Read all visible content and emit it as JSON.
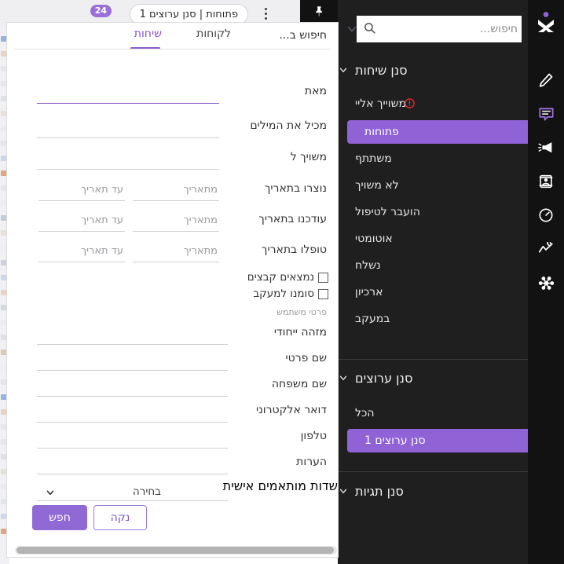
{
  "window": {
    "pin_icon": "pin-icon"
  },
  "tabbar": {
    "tab_label": "פתוחות  |  סנן ערוצים 1",
    "tab_badge": "24",
    "kebab_icon": "more-vertical-icon"
  },
  "panel": {
    "search": {
      "placeholder": "חיפוש...",
      "value": "",
      "icon": "search-icon",
      "caret_icon": "chevron-down-icon"
    },
    "sections": [
      {
        "title": "סנן שיחות",
        "chevron": "chevron-down-icon",
        "items": [
          {
            "label": "משוייך אליי",
            "active": false,
            "alert_icon": "alert-circle-icon"
          },
          {
            "label": "פתוחות",
            "active": true
          },
          {
            "label": "משתתף",
            "active": false
          },
          {
            "label": "לא משויך",
            "active": false
          },
          {
            "label": "הועבר לטיפול",
            "active": false
          },
          {
            "label": "אוטומטי",
            "active": false
          },
          {
            "label": "נשלח",
            "active": false
          },
          {
            "label": "ארכיון",
            "active": false
          },
          {
            "label": "במעקב",
            "active": false
          }
        ]
      },
      {
        "title": "סנן ערוצים",
        "chevron": "chevron-down-icon",
        "items": [
          {
            "label": "הכל",
            "active": false
          },
          {
            "label": "סנן ערוצים 1",
            "active": true
          }
        ]
      },
      {
        "title": "סנן תגיות",
        "chevron": "chevron-down-icon",
        "items": []
      }
    ]
  },
  "dialog": {
    "title": "חיפוש ב...",
    "tabs": [
      {
        "label": "שיחות",
        "active": true
      },
      {
        "label": "לקוחות",
        "active": false
      }
    ],
    "fields": [
      {
        "label": "מאת",
        "value": "",
        "placeholder": "",
        "type": "text",
        "focused": true
      },
      {
        "label": "מכיל את המילים",
        "value": "",
        "placeholder": "",
        "type": "text",
        "focused": false
      },
      {
        "label": "משויך ל",
        "value": "",
        "placeholder": "",
        "type": "text",
        "focused": false
      }
    ],
    "date_ranges": [
      {
        "label": "נוצרו בתאריך",
        "from_placeholder": "מתאריך",
        "to_placeholder": "עד תאריך",
        "from_value": "",
        "to_value": ""
      },
      {
        "label": "עודכנו בתאריך",
        "from_placeholder": "מתאריך",
        "to_placeholder": "עד תאריך",
        "from_value": "",
        "to_value": ""
      },
      {
        "label": "טופלו בתאריך",
        "from_placeholder": "מתאריך",
        "to_placeholder": "עד תאריך",
        "from_value": "",
        "to_value": ""
      }
    ],
    "checkboxes": [
      {
        "label": "נמצאים קבצים",
        "checked": false
      },
      {
        "label": "סומנו למעקב",
        "checked": false
      }
    ],
    "user_section_title": "פרטי משתמש",
    "user_fields": [
      {
        "label": "מזהה ייחודי",
        "value": "",
        "placeholder": ""
      },
      {
        "label": "שם פרטי",
        "value": "",
        "placeholder": ""
      },
      {
        "label": "שם משפחה",
        "value": "",
        "placeholder": ""
      },
      {
        "label": "דואר אלקטרוני",
        "value": "",
        "placeholder": ""
      },
      {
        "label": "טלפון",
        "value": "",
        "placeholder": ""
      },
      {
        "label": "הערות",
        "value": "",
        "placeholder": ""
      }
    ],
    "custom_fields": {
      "label": "שדות מותאמים אישית",
      "selected": "בחירה",
      "chevron": "chevron-down-icon"
    },
    "buttons": {
      "search": "חפש",
      "clear": "נקה"
    }
  },
  "colors": {
    "accent": "#8b5fd0",
    "accent_light": "#9069d4",
    "panel_bg": "#1f1f1f",
    "rail_bg": "#121212",
    "alert": "#e03030"
  }
}
